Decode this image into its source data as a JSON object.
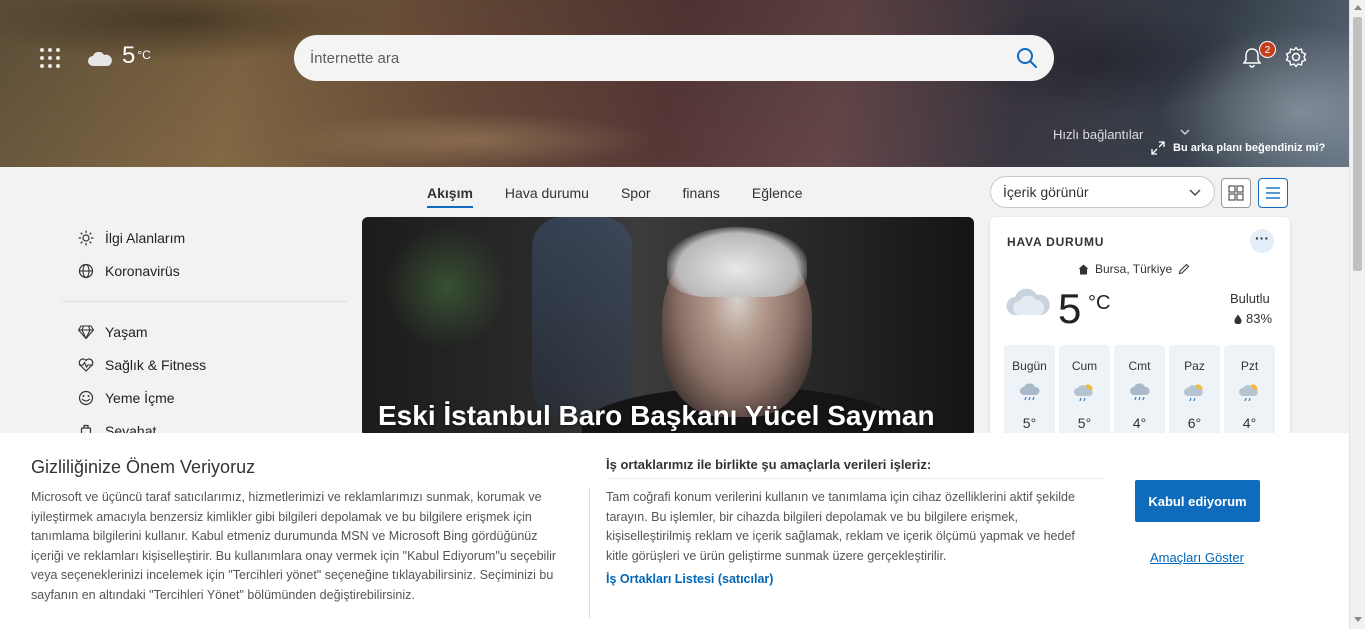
{
  "header": {
    "temperature": "5",
    "temperature_unit": "°C",
    "search_placeholder": "İnternette ara",
    "notification_count": "2",
    "quick_links": "Hızlı bağlantılar",
    "background_question": "Bu arka planı beğendiniz mi?"
  },
  "tabs": [
    {
      "label": "Akışım",
      "active": true
    },
    {
      "label": "Hava durumu"
    },
    {
      "label": "Spor"
    },
    {
      "label": "finans"
    },
    {
      "label": "Eğlence"
    }
  ],
  "content_select": "İçerik görünür",
  "sidebar": {
    "items": [
      {
        "label": "İlgi Alanlarım",
        "icon": "sun-icon"
      },
      {
        "label": "Koronavirüs",
        "icon": "globe-icon"
      },
      {
        "label": "Yaşam",
        "icon": "diamond-icon"
      },
      {
        "label": "Sağlık & Fitness",
        "icon": "heart-pulse-icon"
      },
      {
        "label": "Yeme İçme",
        "icon": "food-icon"
      },
      {
        "label": "Seyahat",
        "icon": "luggage-icon"
      }
    ]
  },
  "hero_card": {
    "headline": "Eski İstanbul Baro Başkanı Yücel Sayman"
  },
  "weather": {
    "title": "HAVA DURUMU",
    "more": "···",
    "location": "Bursa, Türkiye",
    "temp": "5",
    "unit": "°C",
    "condition": "Bulutlu",
    "humidity": "83%",
    "forecast": [
      {
        "day": "Bugün",
        "temp": "5°",
        "icon": "rain-cloud-icon"
      },
      {
        "day": "Cum",
        "temp": "5°",
        "icon": "sun-cloud-rain-icon"
      },
      {
        "day": "Cmt",
        "temp": "4°",
        "icon": "rain-cloud-icon"
      },
      {
        "day": "Paz",
        "temp": "6°",
        "icon": "sun-cloud-rain-icon"
      },
      {
        "day": "Pzt",
        "temp": "4°",
        "icon": "sun-cloud-rain-icon"
      }
    ]
  },
  "consent": {
    "title": "Gizliliğinize Önem Veriyoruz",
    "body": "Microsoft ve üçüncü taraf satıcılarımız, hizmetlerimizi ve reklamlarımızı sunmak, korumak ve iyileştirmek amacıyla benzersiz kimlikler gibi bilgileri depolamak ve bu bilgilere erişmek için tanımlama bilgilerini kullanır. Kabul etmeniz durumunda MSN ve Microsoft Bing gördüğünüz içeriği ve reklamları kişiselleştirir. Bu kullanımlara onay vermek için \"Kabul Ediyorum\"u seçebilir veya seçeneklerinizi incelemek için \"Tercihleri yönet\" seçeneğine tıklayabilirsiniz. Seçiminizi bu sayfanın en altındaki \"Tercihleri Yönet\" bölümünden değiştirebilirsiniz.",
    "purposes_title": "İş ortaklarımız ile birlikte şu amaçlarla verileri işleriz:",
    "purposes_body": "Tam coğrafi konum verilerini kullanın ve tanımlama için cihaz özelliklerini aktif şekilde tarayın. Bu işlemler, bir cihazda bilgileri depolamak ve bu bilgilere erişmek, kişiselleştirilmiş reklam ve içerik sağlamak, reklam ve içerik ölçümü yapmak ve hedef kitle görüşleri ve ürün geliştirme sunmak üzere gerçekleştirilir.",
    "partners_link": "İş Ortakları Listesi (satıcılar)",
    "accept_label": "Kabul ediyorum",
    "show_purposes": "Amaçları Göster"
  },
  "colors": {
    "accent": "#0f6cbd",
    "badge": "#c43e1c",
    "link": "#0067b8"
  }
}
